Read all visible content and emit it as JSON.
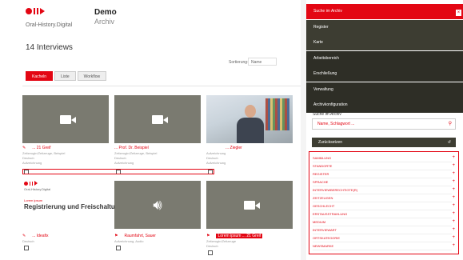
{
  "header": {
    "brand_subtitle": "Oral-History.Digital",
    "app_title": "Demo",
    "app_subtitle": "Archiv"
  },
  "results": {
    "count_label": "14 Interviews",
    "sort_label": "Sortierung:",
    "sort_value": "Name"
  },
  "view_tabs": [
    {
      "label": "Kacheln",
      "active": true
    },
    {
      "label": "Liste",
      "active": false
    },
    {
      "label": "Workflow",
      "active": false
    }
  ],
  "cards": [
    {
      "thumb": "video",
      "title": "... 21 Greif",
      "meta": [
        "Zeitzeugin/Zeitzeuge, Beispiel",
        "Deutsch",
        "Aufzeichnung"
      ]
    },
    {
      "thumb": "video",
      "title": "... Prof. Dr. Beispiel",
      "meta": [
        "Zeitzeugin/Zeitzeuge, Beispiel",
        "Deutsch",
        "Aufzeichnung"
      ]
    },
    {
      "thumb": "photo",
      "title": "... Ziegler",
      "meta": [
        "Aufzeichnung",
        "Deutsch",
        "Aufzeichnung"
      ]
    },
    {
      "thumb": "doc",
      "title": "... Ideafix",
      "meta": [
        "Deutsch"
      ],
      "doc_brand": "Oral-History.Digital",
      "doc_small": "Lorem ipsum",
      "doc_title": "Registrierung und Freischaltung"
    },
    {
      "thumb": "audio",
      "title": "Raumfahrt, Sauer",
      "meta": [
        "Aufzeichnung, Audio"
      ]
    },
    {
      "thumb": "video",
      "title": "Lorem ipsum ... 21 Greif",
      "meta": [
        "Zeitzeugin/Zeitzeuge",
        "Deutsch"
      ]
    }
  ],
  "sidebar": {
    "nav": [
      {
        "label": "Suche im Archiv",
        "active": true
      },
      {
        "label": "Register",
        "active": false
      },
      {
        "label": "Karte",
        "active": false
      },
      {
        "label": "Arbeitsbereich",
        "active": false
      },
      {
        "label": "Erschließung",
        "active": false
      },
      {
        "label": "Verwaltung",
        "active": false
      },
      {
        "label": "Archivkonfiguration",
        "active": false
      }
    ],
    "close_symbol": "×",
    "search_label": "Suche im Archiv",
    "search_value": "Name, Schlagwort ...",
    "reset_label": "Zurücksetzen",
    "facets": [
      "SAMMLUNG",
      "STANDORTE",
      "REGISTER",
      "SPRACHE",
      "INTERVIEWBERECHTIGTE(R)",
      "ZEITZEUGEN",
      "GESCHLECHT",
      "ERSTAUSSTRAHLUNG",
      "MEDIUM",
      "INTERVIEWART",
      "ORTSKATEGORIE",
      "NEWSMARKE"
    ]
  }
}
